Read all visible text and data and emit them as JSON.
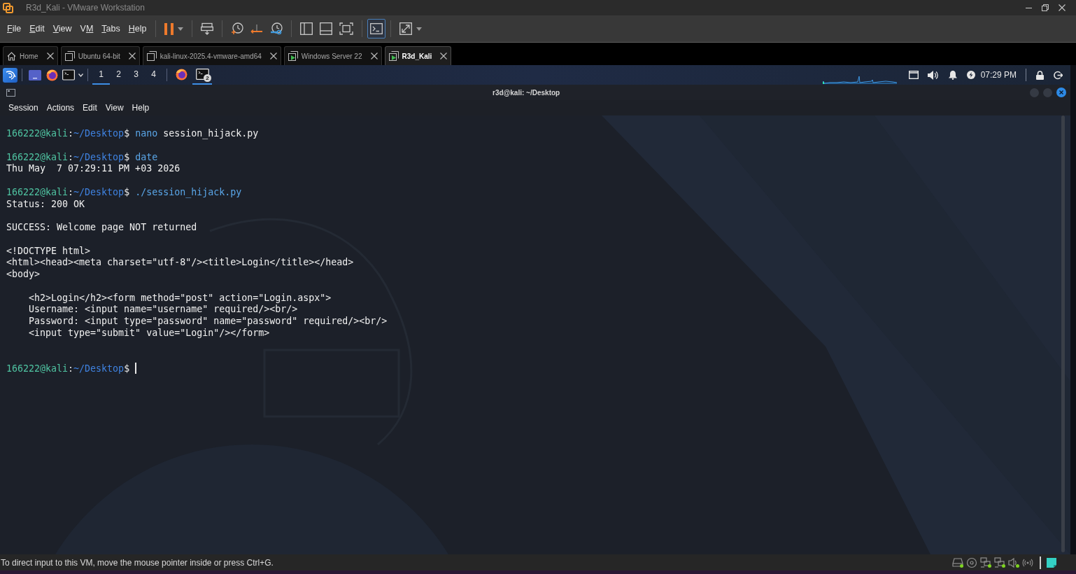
{
  "window": {
    "title": "R3d_Kali - VMware Workstation"
  },
  "menu": [
    {
      "key": "F",
      "post": "ile"
    },
    {
      "key": "E",
      "post": "dit"
    },
    {
      "key": "V",
      "post": "iew"
    },
    {
      "pre": "V",
      "key": "M"
    },
    {
      "key": "T",
      "post": "abs"
    },
    {
      "key": "H",
      "post": "elp"
    }
  ],
  "toolbar": {
    "console_view": {
      "selected": true
    }
  },
  "tabs": [
    {
      "kind": "home",
      "label": "Home",
      "selected": false
    },
    {
      "kind": "vm",
      "label": "Ubuntu 64-bit",
      "running": false,
      "selected": false
    },
    {
      "kind": "vm",
      "label": "kali-linux-2025.4-vmware-amd64",
      "running": false,
      "selected": false
    },
    {
      "kind": "vm",
      "label": "Windows Server 22",
      "running": true,
      "selected": false
    },
    {
      "kind": "vm",
      "label": "R3d_Kali",
      "running": true,
      "selected": true
    }
  ],
  "guest": {
    "panel": {
      "workspaces": [
        {
          "label": "1",
          "selected": true
        },
        {
          "label": "2",
          "selected": false
        },
        {
          "label": "3",
          "selected": false
        },
        {
          "label": "4",
          "selected": false
        }
      ],
      "windows": [
        {
          "kind": "browser",
          "selected": false
        },
        {
          "kind": "terminal",
          "badge": "2",
          "selected": true
        }
      ],
      "clock": "07:29 PM"
    },
    "terminal": {
      "title": "r3d@kali: ~/Desktop",
      "menu": [
        "Session",
        "Actions",
        "Edit",
        "View",
        "Help"
      ],
      "lines": [
        {
          "kind": "prompt",
          "user": "166222@kali",
          "sep": ":",
          "path": "~/Desktop",
          "sign": "$",
          "command": "nano",
          "args": "session_hijack.py"
        },
        {
          "kind": "blank"
        },
        {
          "kind": "prompt",
          "user": "166222@kali",
          "sep": ":",
          "path": "~/Desktop",
          "sign": "$",
          "command": "date"
        },
        {
          "kind": "output",
          "text": "Thu May  7 07:29:11 PM +03 2026"
        },
        {
          "kind": "blank"
        },
        {
          "kind": "prompt",
          "user": "166222@kali",
          "sep": ":",
          "path": "~/Desktop",
          "sign": "$",
          "command": "./session_hijack.py"
        },
        {
          "kind": "output",
          "text": "Status: 200 OK"
        },
        {
          "kind": "blank"
        },
        {
          "kind": "output",
          "text": "SUCCESS: Welcome page NOT returned"
        },
        {
          "kind": "blank"
        },
        {
          "kind": "output",
          "text": "<!DOCTYPE html>"
        },
        {
          "kind": "output",
          "text": "<html><head><meta charset=\"utf-8\"/><title>Login</title></head>"
        },
        {
          "kind": "output",
          "text": "<body>"
        },
        {
          "kind": "blank"
        },
        {
          "kind": "output",
          "text": "    <h2>Login</h2><form method=\"post\" action=\"Login.aspx\">"
        },
        {
          "kind": "output",
          "text": "    Username: <input name=\"username\" required/><br/>"
        },
        {
          "kind": "output",
          "text": "    Password: <input type=\"password\" name=\"password\" required/><br/>"
        },
        {
          "kind": "output",
          "text": "    <input type=\"submit\" value=\"Login\"/></form>"
        },
        {
          "kind": "blank"
        },
        {
          "kind": "blank"
        },
        {
          "kind": "prompt",
          "user": "166222@kali",
          "sep": ":",
          "path": "~/Desktop",
          "sign": "$",
          "cursor": true
        }
      ]
    }
  },
  "status_bar": {
    "message": "To direct input to this VM, move the mouse pointer inside or press Ctrl+G.",
    "devices": [
      {
        "kind": "disk",
        "connected": true
      },
      {
        "kind": "disc",
        "connected": false
      },
      {
        "kind": "network",
        "connected": true
      },
      {
        "kind": "network",
        "connected": true
      },
      {
        "kind": "sound",
        "connected": true
      },
      {
        "kind": "wireless",
        "connected": false
      }
    ]
  }
}
